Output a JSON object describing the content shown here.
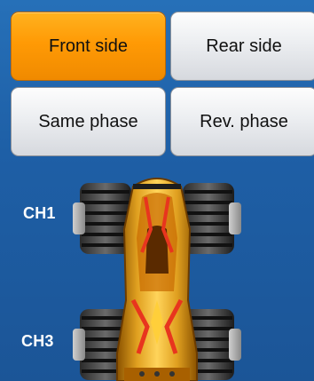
{
  "buttons": {
    "front_side": "Front side",
    "rear_side": "Rear side",
    "same_phase": "Same phase",
    "rev_phase": "Rev. phase"
  },
  "channels": {
    "ch1": "CH1",
    "ch3": "CH3"
  },
  "state": {
    "selected": "front_side"
  },
  "colors": {
    "background": "#1f62a8",
    "accent": "#ff9a05",
    "button": "#e6e8eb",
    "car_body": "#d98a0f"
  },
  "icons": {
    "vehicle": "monster-truck-top-view"
  }
}
